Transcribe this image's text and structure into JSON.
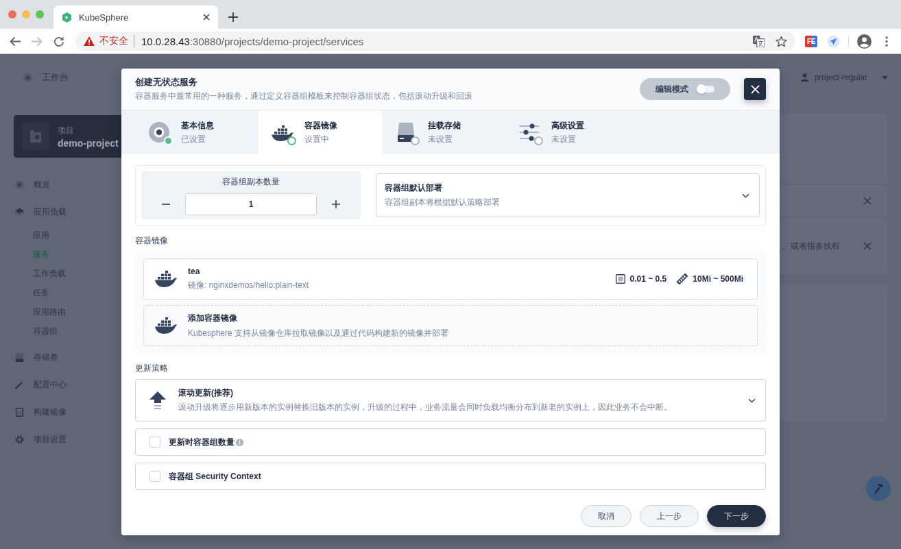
{
  "browser": {
    "tab": {
      "title": "KubeSphere"
    },
    "nav": [
      {
        "kind": "back",
        "disabled": false
      },
      {
        "kind": "forward",
        "disabled": true
      },
      {
        "kind": "reload",
        "disabled": false
      }
    ],
    "address": {
      "security": "不安全",
      "host": "10.0.28.43",
      "path": ":30880/projects/demo-project/services"
    },
    "extensions": [
      {
        "kind": "badge",
        "label": "FE"
      },
      {
        "kind": "icon"
      }
    ]
  },
  "header": {
    "workbench": "工作台",
    "user": "project-regular"
  },
  "project": {
    "caption": "项目",
    "name": "demo-project"
  },
  "sidebar": {
    "items": [
      {
        "label": "概览",
        "selected": false
      },
      {
        "label": "应用负载",
        "selected": false,
        "children": [
          {
            "label": "应用",
            "selected": false
          },
          {
            "label": "服务",
            "selected": true
          },
          {
            "label": "工作负载",
            "selected": false
          },
          {
            "label": "任务",
            "selected": false
          },
          {
            "label": "应用路由",
            "selected": false
          },
          {
            "label": "容器组",
            "selected": false
          }
        ]
      },
      {
        "label": "存储卷",
        "selected": false
      },
      {
        "label": "配置中心",
        "selected": false
      },
      {
        "label": "构建镜像",
        "selected": false
      },
      {
        "label": "项目设置",
        "selected": false
      }
    ]
  },
  "notices": [
    {
      "closable": true
    },
    {
      "text": "、或者指多线程",
      "closable": true
    }
  ],
  "modal": {
    "title": "创建无状态服务",
    "description": "容器服务中最常用的一种服务，通过定义容器组模板来控制容器组状态，包括滚动升级和回滚",
    "edit_mode": {
      "label": "编辑模式",
      "on": false
    },
    "steps": [
      {
        "title": "基本信息",
        "status": "已设置",
        "selected": false,
        "done": true
      },
      {
        "title": "容器镜像",
        "status": "设置中",
        "selected": true,
        "done": false
      },
      {
        "title": "挂载存储",
        "status": "未设置",
        "selected": false,
        "done": false
      },
      {
        "title": "高级设置",
        "status": "未设置",
        "selected": false,
        "done": false
      }
    ],
    "replicas": {
      "label": "容器组副本数量",
      "value": "1"
    },
    "deploy": {
      "title": "容器组默认部署",
      "description": "容器组副本将根据默认策略部署"
    },
    "images_label": "容器镜像",
    "containers": [
      {
        "name": "tea",
        "image": "镜像: nginxdemos/hello:plain-text",
        "cpu": "0.01 ~ 0.5",
        "memory": "10Mi ~ 500Mi"
      }
    ],
    "add_container": {
      "title": "添加容器镜像",
      "description": "Kubesphere 支持从镜像仓库拉取镜像以及通过代码构建新的镜像并部署"
    },
    "strategy_label": "更新策略",
    "strategy": {
      "title": "滚动更新(推荐)",
      "description": "滚动升级将逐步用新版本的实例替换旧版本的实例，升级的过程中，业务流量会同时负载均衡分布到新老的实例上，因此业务不会中断。"
    },
    "options": [
      {
        "label": "更新时容器组数量",
        "checked": false,
        "info": true
      },
      {
        "label": "容器组 Security Context",
        "checked": false,
        "info": false
      }
    ],
    "buttons": [
      {
        "label": "取消",
        "kind": "default"
      },
      {
        "label": "上一步",
        "kind": "default"
      },
      {
        "label": "下一步",
        "kind": "primary"
      }
    ]
  }
}
